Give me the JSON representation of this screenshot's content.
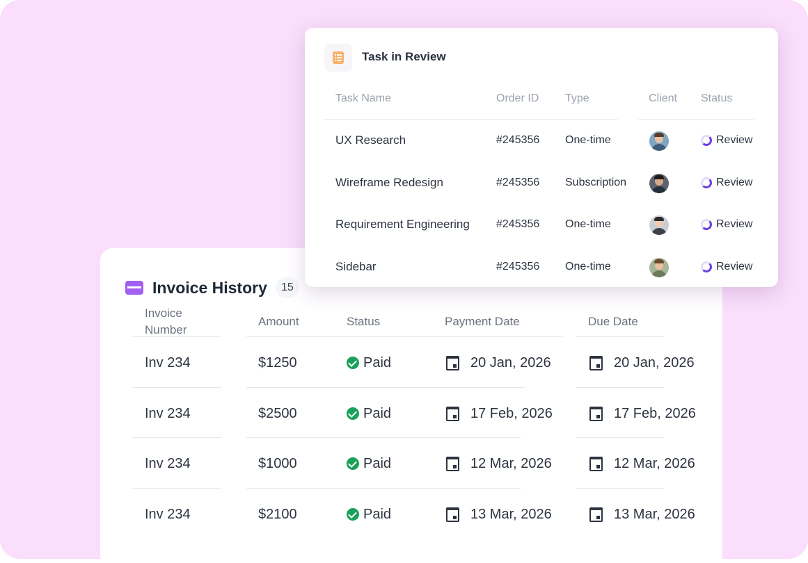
{
  "invoice": {
    "title": "Invoice History",
    "count": "15",
    "headers": {
      "number": "Invoice",
      "number2": "Number",
      "amount": "Amount",
      "status": "Status",
      "payment": "Payment Date",
      "due": "Due Date"
    },
    "rows": [
      {
        "number": "Inv 234",
        "amount": "$1250",
        "status": "Paid",
        "payment": "20 Jan, 2026",
        "due": "20 Jan, 2026"
      },
      {
        "number": "Inv 234",
        "amount": "$2500",
        "status": "Paid",
        "payment": "17 Feb, 2026",
        "due": "17 Feb, 2026"
      },
      {
        "number": "Inv 234",
        "amount": "$1000",
        "status": "Paid",
        "payment": "12 Mar, 2026",
        "due": "12 Mar, 2026"
      },
      {
        "number": "Inv 234",
        "amount": "$2100",
        "status": "Paid",
        "payment": "13 Mar, 2026",
        "due": "13 Mar, 2026"
      }
    ]
  },
  "tasks": {
    "title": "Task in Review",
    "headers": {
      "name": "Task Name",
      "order": "Order ID",
      "type": "Type",
      "client": "Client",
      "status": "Status"
    },
    "rows": [
      {
        "name": "UX Research",
        "order": "#245356",
        "type": "One-time",
        "status": "Review"
      },
      {
        "name": "Wireframe Redesign",
        "order": "#245356",
        "type": "Subscription",
        "status": "Review"
      },
      {
        "name": "Requirement Engineering",
        "order": "#245356",
        "type": "One-time",
        "status": "Review"
      },
      {
        "name": "Sidebar",
        "order": "#245356",
        "type": "One-time",
        "status": "Review"
      }
    ]
  },
  "colors": {
    "background": "#fadefb",
    "paid": "#1aa05b",
    "review": "#6d3fe0",
    "invoice_icon": "#a260f0",
    "task_icon": "#f6b26b"
  },
  "icons": {
    "invoice": "credit-card-icon",
    "task": "document-list-icon",
    "paid": "check-circle-icon",
    "date": "calendar-icon",
    "review": "progress-spinner-icon"
  }
}
